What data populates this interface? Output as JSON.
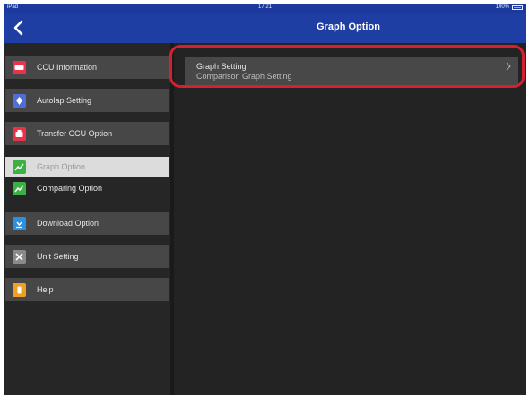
{
  "status_bar": {
    "device": "iPad",
    "time": "17:21",
    "battery": "100%"
  },
  "nav": {
    "title": "Graph Option",
    "back_icon": "chevron-left-icon"
  },
  "sidebar": {
    "items": [
      {
        "label": "CCU Information",
        "icon": "ccu-info-icon",
        "icon_color": "#e8334a"
      },
      {
        "label": "Autolap Setting",
        "icon": "autolap-icon",
        "icon_color": "#4f6fd8"
      },
      {
        "label": "Transfer CCU Option",
        "icon": "transfer-icon",
        "icon_color": "#e8334a"
      },
      {
        "label": "Graph Option",
        "icon": "graph-icon",
        "icon_color": "#3cb043",
        "selected": true
      },
      {
        "label": "Comparing Option",
        "icon": "comparing-graph-icon",
        "icon_color": "#3cb043"
      },
      {
        "label": "Download Option",
        "icon": "download-icon",
        "icon_color": "#2d8fe0"
      },
      {
        "label": "Unit Setting",
        "icon": "tools-icon",
        "icon_color": "#8a8a8a"
      },
      {
        "label": "Help",
        "icon": "help-icon",
        "icon_color": "#f0a020"
      }
    ]
  },
  "content": {
    "rows": [
      {
        "label": "Graph Setting"
      },
      {
        "label": "Comparison Graph Setting"
      }
    ]
  },
  "colors": {
    "nav_bar": "#1e3ea3",
    "highlight": "#d42030",
    "background": "#232323"
  }
}
